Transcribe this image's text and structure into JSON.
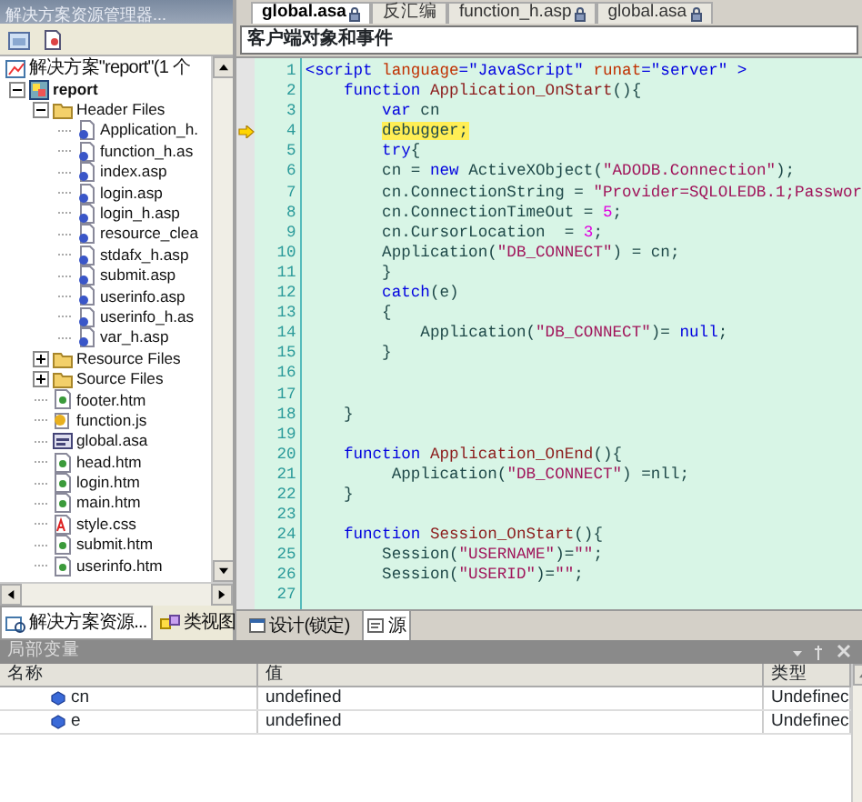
{
  "explorer": {
    "title": "解决方案资源管理器...",
    "tree": [
      {
        "label": "解决方案\"report\"(1 个",
        "kind": "solution",
        "children": [
          {
            "label": "report",
            "kind": "project",
            "expanded": true,
            "children": [
              {
                "label": "Header Files",
                "kind": "folder",
                "expanded": true,
                "children": [
                  {
                    "label": "Application_h.",
                    "kind": "asp"
                  },
                  {
                    "label": "function_h.as",
                    "kind": "asp"
                  },
                  {
                    "label": "index.asp",
                    "kind": "asp"
                  },
                  {
                    "label": "login.asp",
                    "kind": "asp"
                  },
                  {
                    "label": "login_h.asp",
                    "kind": "asp"
                  },
                  {
                    "label": "resource_clea",
                    "kind": "asp"
                  },
                  {
                    "label": "stdafx_h.asp",
                    "kind": "asp"
                  },
                  {
                    "label": "submit.asp",
                    "kind": "asp"
                  },
                  {
                    "label": "userinfo.asp",
                    "kind": "asp"
                  },
                  {
                    "label": "userinfo_h.as",
                    "kind": "asp"
                  },
                  {
                    "label": "var_h.asp",
                    "kind": "asp"
                  }
                ]
              },
              {
                "label": "Resource Files",
                "kind": "folder",
                "expanded": false
              },
              {
                "label": "Source Files",
                "kind": "folder",
                "expanded": false
              },
              {
                "label": "footer.htm",
                "kind": "htm"
              },
              {
                "label": "function.js",
                "kind": "js"
              },
              {
                "label": "global.asa",
                "kind": "asa"
              },
              {
                "label": "head.htm",
                "kind": "htm"
              },
              {
                "label": "login.htm",
                "kind": "htm"
              },
              {
                "label": "main.htm",
                "kind": "htm"
              },
              {
                "label": "style.css",
                "kind": "css"
              },
              {
                "label": "submit.htm",
                "kind": "htm"
              },
              {
                "label": "userinfo.htm",
                "kind": "htm"
              }
            ]
          }
        ]
      }
    ],
    "tabs": [
      {
        "label": "解决方案资源...",
        "selected": true
      },
      {
        "label": "类视图",
        "selected": false
      }
    ]
  },
  "editor": {
    "tabs": [
      {
        "label": "global.asa",
        "selected": true,
        "locked": true
      },
      {
        "label": "反汇编",
        "selected": false,
        "locked": false
      },
      {
        "label": "function_h.asp",
        "selected": false,
        "locked": true
      },
      {
        "label": "global.asa",
        "selected": false,
        "locked": true
      }
    ],
    "object_dropdown": "客户端对象和事件",
    "lines": [
      {
        "no": "1",
        "current": false,
        "segments": [
          {
            "text": "<script",
            "kind": "keyword"
          },
          {
            "text": " language",
            "kind": "attribute"
          },
          {
            "text": "=",
            "kind": "keyword"
          },
          {
            "text": "\"JavaScript\"",
            "kind": "keyword"
          },
          {
            "text": " runat",
            "kind": "attribute"
          },
          {
            "text": "=",
            "kind": "keyword"
          },
          {
            "text": "\"server\"",
            "kind": "keyword"
          },
          {
            "text": " >",
            "kind": "keyword"
          }
        ]
      },
      {
        "no": "2",
        "current": false,
        "segments": [
          {
            "text": "    function",
            "kind": "keyword"
          },
          {
            "text": " Application_OnStart",
            "kind": "identifier"
          },
          {
            "text": "(){",
            "kind": "plain"
          }
        ]
      },
      {
        "no": "3",
        "current": false,
        "segments": [
          {
            "text": "        var",
            "kind": "keyword"
          },
          {
            "text": " cn",
            "kind": "plain"
          }
        ]
      },
      {
        "no": "4",
        "current": true,
        "segments": [
          {
            "text": "        debugger;",
            "kind": "plain"
          }
        ]
      },
      {
        "no": "5",
        "current": false,
        "segments": [
          {
            "text": "        try",
            "kind": "keyword"
          },
          {
            "text": "{",
            "kind": "plain"
          }
        ]
      },
      {
        "no": "6",
        "current": false,
        "segments": [
          {
            "text": "        cn = ",
            "kind": "plain"
          },
          {
            "text": "new",
            "kind": "keyword"
          },
          {
            "text": " ActiveXObject(",
            "kind": "plain"
          },
          {
            "text": "\"ADODB.Connection\"",
            "kind": "string"
          },
          {
            "text": ");",
            "kind": "plain"
          }
        ]
      },
      {
        "no": "7",
        "current": false,
        "segments": [
          {
            "text": "        cn.ConnectionString = ",
            "kind": "plain"
          },
          {
            "text": "\"Provider=SQLOLEDB.1;Passwor",
            "kind": "string"
          }
        ]
      },
      {
        "no": "8",
        "current": false,
        "segments": [
          {
            "text": "        cn.ConnectionTimeOut = ",
            "kind": "plain"
          },
          {
            "text": "5",
            "kind": "number"
          },
          {
            "text": ";",
            "kind": "plain"
          }
        ]
      },
      {
        "no": "9",
        "current": false,
        "segments": [
          {
            "text": "        cn.CursorLocation  = ",
            "kind": "plain"
          },
          {
            "text": "3",
            "kind": "number"
          },
          {
            "text": ";",
            "kind": "plain"
          }
        ]
      },
      {
        "no": "10",
        "current": false,
        "segments": [
          {
            "text": "        Application(",
            "kind": "plain"
          },
          {
            "text": "\"DB_CONNECT\"",
            "kind": "string"
          },
          {
            "text": ") = cn;",
            "kind": "plain"
          }
        ]
      },
      {
        "no": "11",
        "current": false,
        "segments": [
          {
            "text": "        }",
            "kind": "plain"
          }
        ]
      },
      {
        "no": "12",
        "current": false,
        "segments": [
          {
            "text": "        catch",
            "kind": "keyword"
          },
          {
            "text": "(e)",
            "kind": "plain"
          }
        ]
      },
      {
        "no": "13",
        "current": false,
        "segments": [
          {
            "text": "        {",
            "kind": "plain"
          }
        ]
      },
      {
        "no": "14",
        "current": false,
        "segments": [
          {
            "text": "            Application(",
            "kind": "plain"
          },
          {
            "text": "\"DB_CONNECT\"",
            "kind": "string"
          },
          {
            "text": ")= ",
            "kind": "plain"
          },
          {
            "text": "null",
            "kind": "keyword"
          },
          {
            "text": ";",
            "kind": "plain"
          }
        ]
      },
      {
        "no": "15",
        "current": false,
        "segments": [
          {
            "text": "        }",
            "kind": "plain"
          }
        ]
      },
      {
        "no": "16",
        "current": false
      },
      {
        "no": "17",
        "current": false
      },
      {
        "no": "18",
        "current": false,
        "segments": [
          {
            "text": "    }",
            "kind": "plain"
          }
        ]
      },
      {
        "no": "19",
        "current": false
      },
      {
        "no": "20",
        "current": false,
        "segments": [
          {
            "text": "    function",
            "kind": "keyword"
          },
          {
            "text": " Application_OnEnd",
            "kind": "identifier"
          },
          {
            "text": "(){",
            "kind": "plain"
          }
        ]
      },
      {
        "no": "21",
        "current": false,
        "segments": [
          {
            "text": "         Application(",
            "kind": "plain"
          },
          {
            "text": "\"DB_CONNECT\"",
            "kind": "string"
          },
          {
            "text": ") =nll;",
            "kind": "plain"
          }
        ]
      },
      {
        "no": "22",
        "current": false,
        "segments": [
          {
            "text": "    }",
            "kind": "plain"
          }
        ]
      },
      {
        "no": "23",
        "current": false
      },
      {
        "no": "24",
        "current": false,
        "segments": [
          {
            "text": "    function",
            "kind": "keyword"
          },
          {
            "text": " Session_OnStart",
            "kind": "identifier"
          },
          {
            "text": "(){",
            "kind": "plain"
          }
        ]
      },
      {
        "no": "25",
        "current": false,
        "segments": [
          {
            "text": "        Session(",
            "kind": "plain"
          },
          {
            "text": "\"USERNAME\"",
            "kind": "string"
          },
          {
            "text": ")=",
            "kind": "plain"
          },
          {
            "text": "\"\"",
            "kind": "string"
          },
          {
            "text": ";",
            "kind": "plain"
          }
        ]
      },
      {
        "no": "26",
        "current": false,
        "segments": [
          {
            "text": "        Session(",
            "kind": "plain"
          },
          {
            "text": "\"USERID\"",
            "kind": "string"
          },
          {
            "text": ")=",
            "kind": "plain"
          },
          {
            "text": "\"\"",
            "kind": "string"
          },
          {
            "text": ";",
            "kind": "plain"
          }
        ]
      },
      {
        "no": "27",
        "current": false
      }
    ],
    "view_tabs": [
      {
        "label": "设计(锁定)",
        "selected": false
      },
      {
        "label": "源",
        "selected": true
      }
    ]
  },
  "locals": {
    "title": "局部变量",
    "columns": [
      "名称",
      "值",
      "类型"
    ],
    "rows": [
      {
        "name": "cn",
        "value": "undefined",
        "type": "Undefinec"
      },
      {
        "name": "e",
        "value": "undefined",
        "type": "Undefinec"
      }
    ]
  }
}
